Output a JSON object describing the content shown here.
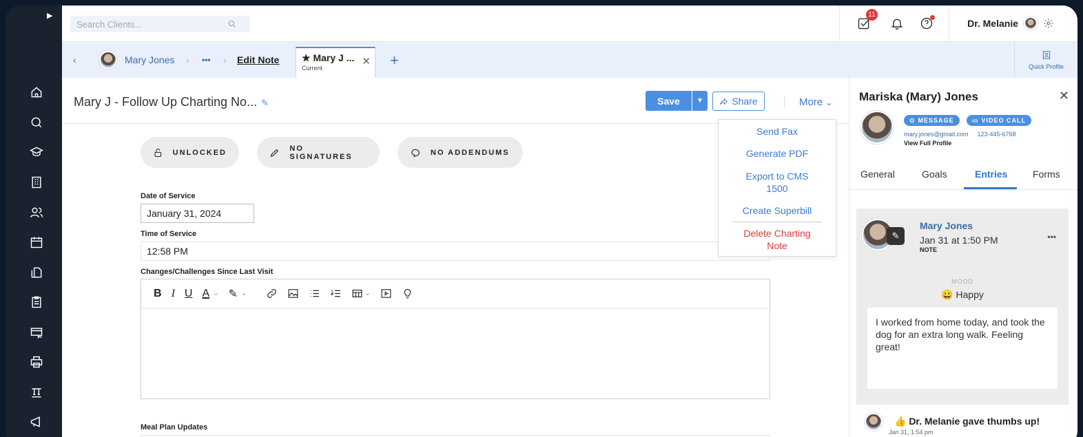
{
  "sidebar": {
    "icons": [
      "home-icon",
      "chat-icon",
      "graduation-cap-icon",
      "building-icon",
      "users-icon",
      "calendar-icon",
      "documents-icon",
      "clipboard-icon",
      "billing-card-icon",
      "printer-icon",
      "scale-icon",
      "megaphone-icon"
    ]
  },
  "topbar": {
    "search_placeholder": "Search Clients...",
    "tasks_badge": "11",
    "user_name": "Dr. Melanie"
  },
  "tabs": {
    "client": "Mary Jones",
    "ellipsis": "•••",
    "edit_note": "Edit Note",
    "active_tab": "★ Mary J ...",
    "active_sub": "Current",
    "quick_profile": "Quick Profile"
  },
  "note": {
    "title": "Mary J - Follow Up Charting No...",
    "save": "Save",
    "share": "Share",
    "more": "More",
    "status": [
      "UNLOCKED",
      "NO SIGNATURES",
      "NO ADDENDUMS"
    ],
    "date_label": "Date of Service",
    "date_value": "January 31, 2024",
    "time_label": "Time of Service",
    "time_value": "12:58 PM",
    "changes_label": "Changes/Challenges Since Last Visit",
    "meal_label": "Meal Plan Updates"
  },
  "more_menu": {
    "send_fax": "Send Fax",
    "generate_pdf": "Generate PDF",
    "export_cms": "Export to CMS 1500",
    "create_superbill": "Create Superbill",
    "delete_note": "Delete Charting Note"
  },
  "panel": {
    "name": "Mariska (Mary) Jones",
    "message": "MESSAGE",
    "video_call": "VIDEO CALL",
    "email": "mary.jones@gmail.com",
    "phone": "123-445-6768",
    "view_profile": "View Full Profile",
    "tabs": [
      "General",
      "Goals",
      "Entries",
      "Forms"
    ],
    "entry_author": "Mary Jones",
    "entry_time": "Jan 31 at 1:50 PM",
    "entry_type": "NOTE",
    "mood_label": "MOOD",
    "mood_value": "😀 Happy",
    "entry_text": "I worked from home today, and took the dog for an extra long walk. Feeling great!",
    "activity_text": "👍 Dr. Melanie gave thumbs up!",
    "activity_time": "Jan 31, 1:54 pm"
  },
  "colors": {
    "accent": "#4a90e2",
    "danger": "#e5343b",
    "sidebar": "#1a2230"
  }
}
